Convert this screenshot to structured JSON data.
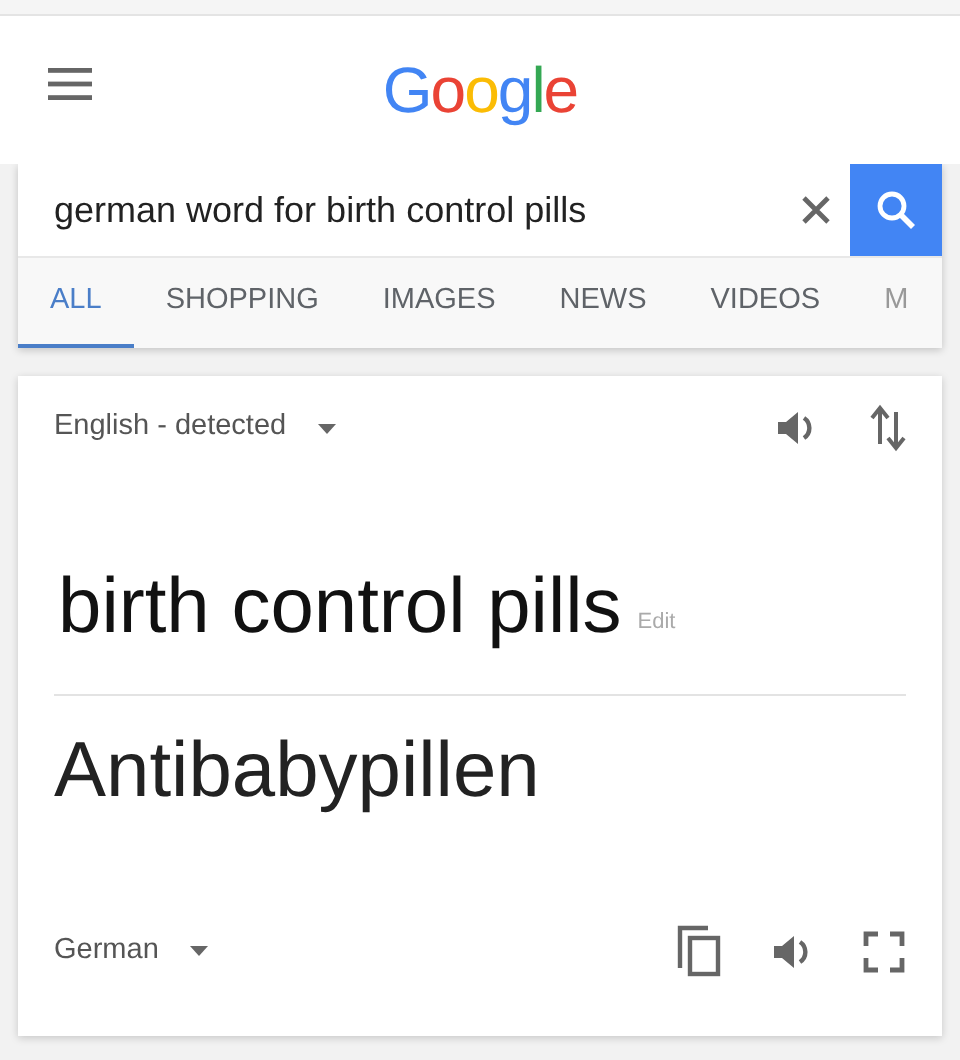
{
  "header": {
    "logo": "Google"
  },
  "search": {
    "value": "german word for birth control pills"
  },
  "tabs": [
    {
      "label": "ALL",
      "selected": true
    },
    {
      "label": "SHOPPING",
      "selected": false
    },
    {
      "label": "IMAGES",
      "selected": false
    },
    {
      "label": "NEWS",
      "selected": false
    },
    {
      "label": "VIDEOS",
      "selected": false
    },
    {
      "label": "M",
      "selected": false
    }
  ],
  "translator": {
    "source_language": "English - detected",
    "source_text": "birth control pills",
    "edit_link": "Edit",
    "translation": "Antibabypillen",
    "target_language": "German"
  }
}
